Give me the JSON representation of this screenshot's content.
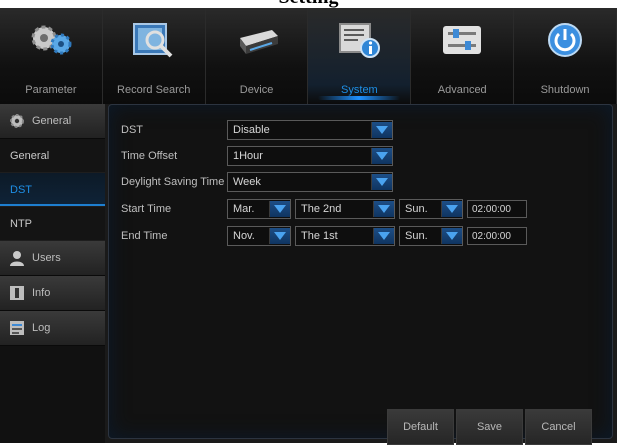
{
  "window_title": "Setting",
  "tabs": [
    {
      "label": "Parameter",
      "icon": "gears-icon"
    },
    {
      "label": "Record Search",
      "icon": "record-search-icon"
    },
    {
      "label": "Device",
      "icon": "hard-drive-icon"
    },
    {
      "label": "System",
      "icon": "system-info-icon",
      "active": true
    },
    {
      "label": "Advanced",
      "icon": "sliders-icon"
    },
    {
      "label": "Shutdown",
      "icon": "power-icon"
    }
  ],
  "sidebar": {
    "group_general": "General",
    "items": [
      "General",
      "DST",
      "NTP"
    ],
    "active_item": "DST",
    "group_users": "Users",
    "group_info": "Info",
    "group_log": "Log"
  },
  "form": {
    "dst": {
      "label": "DST",
      "value": "Disable"
    },
    "time_offset": {
      "label": "Time Offset",
      "value": "1Hour"
    },
    "dst_mode": {
      "label": "Deylight Saving Time",
      "value": "Week"
    },
    "start_time": {
      "label": "Start Time",
      "month": "Mar.",
      "week": "The 2nd",
      "day": "Sun.",
      "time": "02:00:00"
    },
    "end_time": {
      "label": "End Time",
      "month": "Nov.",
      "week": "The 1st",
      "day": "Sun.",
      "time": "02:00:00"
    }
  },
  "buttons": {
    "default": "Default",
    "save": "Save",
    "cancel": "Cancel"
  },
  "colors": {
    "accent": "#1e8fe6",
    "background": "#121212"
  }
}
